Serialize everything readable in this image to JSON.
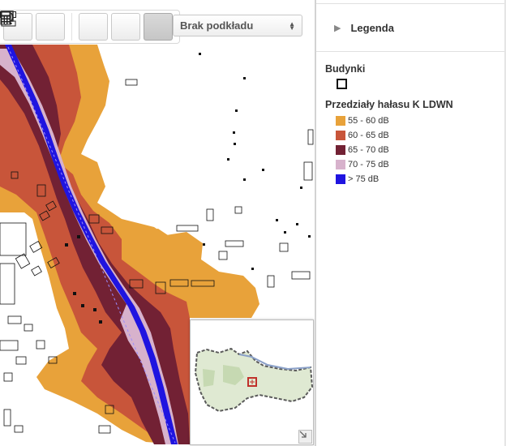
{
  "toolbar": {
    "tools": [
      {
        "name": "measure-distance",
        "icon": "ruler-horizontal-icon",
        "active": false
      },
      {
        "name": "measure-area",
        "icon": "ruler-corner-icon",
        "active": false
      },
      {
        "name": "info",
        "icon": "info-bubble-icon",
        "active": false
      },
      {
        "name": "sound",
        "icon": "speaker-icon",
        "active": false
      },
      {
        "name": "calculator",
        "icon": "calculator-icon",
        "active": true
      }
    ]
  },
  "basemap": {
    "selected": "Brak podkładu"
  },
  "legend": {
    "title": "Legenda",
    "buildings_title": "Budynki",
    "noise_title": "Przedziały hałasu K LDWN",
    "classes": [
      {
        "label": "55 - 60 dB",
        "color": "#E8A23A"
      },
      {
        "label": "60 - 65 dB",
        "color": "#C8553A"
      },
      {
        "label": "65 - 70 dB",
        "color": "#722134"
      },
      {
        "label": "70 - 75 dB",
        "color": "#D7B2CC"
      },
      {
        "label": "> 75 dB",
        "color": "#1F14E0"
      }
    ]
  },
  "map_colors": {
    "c55": "#E8A23A",
    "c60": "#C8553A",
    "c65": "#722134",
    "c70": "#D7B2CC",
    "c75": "#1F14E0",
    "building": "#111111"
  }
}
